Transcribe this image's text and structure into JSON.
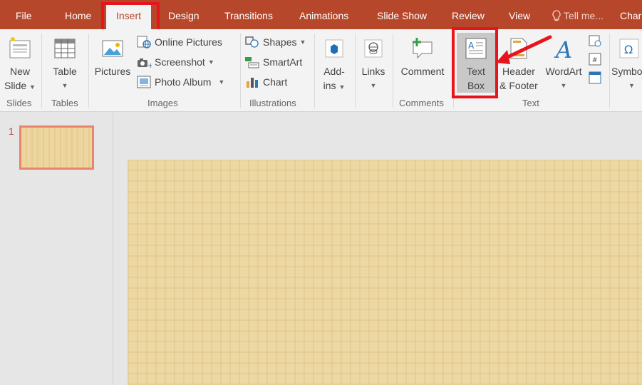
{
  "tabs": [
    {
      "label": "File"
    },
    {
      "label": "Home"
    },
    {
      "label": "Insert"
    },
    {
      "label": "Design"
    },
    {
      "label": "Transitions"
    },
    {
      "label": "Animations"
    },
    {
      "label": "Slide Show"
    },
    {
      "label": "Review"
    },
    {
      "label": "View"
    }
  ],
  "tell_me": "Tell me...",
  "truncated_tab": "Char",
  "ribbon": {
    "slides": {
      "new_slide_line1": "New",
      "new_slide_line2": "Slide",
      "group": "Slides"
    },
    "tables": {
      "table": "Table",
      "group": "Tables"
    },
    "images": {
      "pictures": "Pictures",
      "online_pictures": "Online Pictures",
      "screenshot": "Screenshot",
      "photo_album": "Photo Album",
      "group": "Images"
    },
    "illustrations": {
      "shapes": "Shapes",
      "smartart": "SmartArt",
      "chart": "Chart",
      "group": "Illustrations"
    },
    "addins": {
      "line1": "Add-",
      "line2": "ins"
    },
    "links": {
      "label": "Links"
    },
    "comments": {
      "comment": "Comment",
      "group": "Comments"
    },
    "text": {
      "textbox_line1": "Text",
      "textbox_line2": "Box",
      "header_line1": "Header",
      "header_line2": "& Footer",
      "wordart": "WordArt",
      "group": "Text"
    },
    "symbols": {
      "label": "Symbo"
    }
  },
  "slides_pane": {
    "slide_number": "1"
  },
  "colors": {
    "accent": "#b7472a",
    "highlight": "#e8141b"
  }
}
